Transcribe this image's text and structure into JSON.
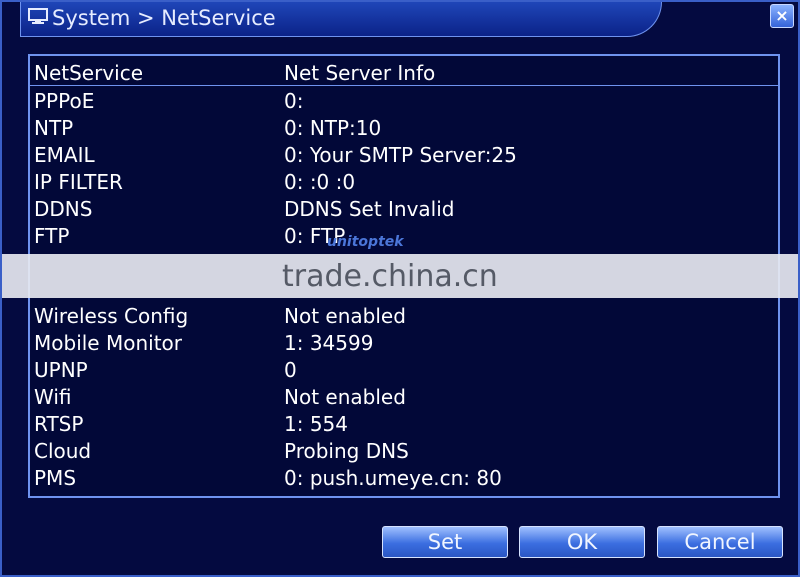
{
  "window": {
    "title": "System > NetService",
    "close_label": "×"
  },
  "table": {
    "header": {
      "name": "NetService",
      "info": "Net Server Info"
    },
    "rows": [
      {
        "name": "PPPoE",
        "info": "0:"
      },
      {
        "name": "NTP",
        "info": "0: NTP:10"
      },
      {
        "name": "EMAIL",
        "info": "0: Your SMTP Server:25"
      },
      {
        "name": "IP FILTER",
        "info": "0: :0 :0"
      },
      {
        "name": "DDNS",
        "info": "DDNS Set Invalid"
      },
      {
        "name": "FTP",
        "info": "0: FTP"
      },
      {
        "name": "Wireless Config",
        "info": "Not enabled"
      },
      {
        "name": "Mobile Monitor",
        "info": "1: 34599"
      },
      {
        "name": "UPNP",
        "info": "0"
      },
      {
        "name": "Wifi",
        "info": "Not enabled"
      },
      {
        "name": "RTSP",
        "info": "1: 554"
      },
      {
        "name": "Cloud",
        "info": "Probing DNS"
      },
      {
        "name": "PMS",
        "info": "0: push.umeye.cn: 80"
      }
    ]
  },
  "watermark": {
    "text": "trade.china.cn",
    "logo": "unitoptek"
  },
  "buttons": {
    "set": "Set",
    "ok": "OK",
    "cancel": "Cancel"
  }
}
